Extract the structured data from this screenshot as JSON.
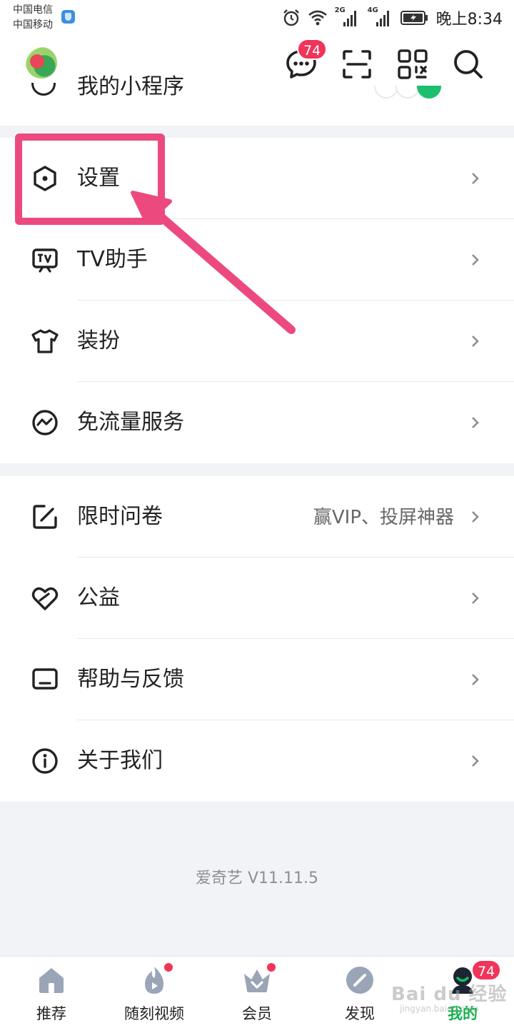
{
  "status_bar": {
    "carrier_1": "中国电信",
    "carrier_2": "中国移动",
    "net_label_1": "2G",
    "net_label_2": "4G",
    "time": "晚上8:34"
  },
  "header": {
    "message_badge": "74",
    "partially_visible_row": "我的小程序",
    "icons": [
      "message-icon",
      "scan-icon",
      "qrcode-icon",
      "search-icon"
    ]
  },
  "menu_group_1": [
    {
      "label": "设置",
      "icon": "settings-hexagon-icon"
    },
    {
      "label": "TV助手",
      "icon": "tv-icon"
    },
    {
      "label": "装扮",
      "icon": "tshirt-icon"
    },
    {
      "label": "免流量服务",
      "icon": "wave-circle-icon"
    }
  ],
  "menu_group_2": [
    {
      "label": "限时问卷",
      "hint": "赢VIP、投屏神器",
      "icon": "edit-icon"
    },
    {
      "label": "公益",
      "icon": "heart-icon"
    },
    {
      "label": "帮助与反馈",
      "icon": "feedback-icon"
    },
    {
      "label": "关于我们",
      "icon": "info-icon"
    }
  ],
  "version": "爱奇艺 V11.11.5",
  "bottom_nav": {
    "items": [
      {
        "label": "推荐"
      },
      {
        "label": "随刻视频"
      },
      {
        "label": "会员"
      },
      {
        "label": "发现"
      },
      {
        "label": "我的"
      }
    ],
    "active_index": 4,
    "profile_badge": "74"
  },
  "watermark": {
    "main": "Bai du 经验",
    "sub": "jingyan.baidu.com"
  },
  "colors": {
    "accent_green": "#12b24a",
    "badge_red": "#f0345a",
    "annotation_pink": "#ec4a7f",
    "background": "#f1f3f7"
  }
}
